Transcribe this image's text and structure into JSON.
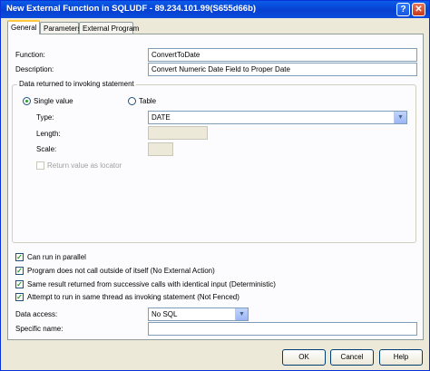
{
  "window": {
    "title": "New External Function in SQLUDF - 89.234.101.99(S655d66b)"
  },
  "tabs": [
    "General",
    "Parameters",
    "External Program"
  ],
  "general": {
    "function_label": "Function:",
    "function_value": "ConvertToDate",
    "description_label": "Description:",
    "description_value": "Convert Numeric Date Field to Proper Date"
  },
  "returned": {
    "legend": "Data returned to invoking statement",
    "single_value": "Single value",
    "table": "Table",
    "type_label": "Type:",
    "type_value": "DATE",
    "length_label": "Length:",
    "length_value": "",
    "scale_label": "Scale:",
    "scale_value": "",
    "locator_label": "Return value as locator"
  },
  "options": [
    {
      "label": "Can run in parallel",
      "checked": true
    },
    {
      "label": "Program does not call outside of itself (No External Action)",
      "checked": true
    },
    {
      "label": "Same result returned from successive calls with identical input (Deterministic)",
      "checked": true
    },
    {
      "label": "Attempt to run in same thread as invoking statement (Not Fenced)",
      "checked": true
    }
  ],
  "data_access": {
    "label": "Data access:",
    "value": "No SQL"
  },
  "specific_name": {
    "label": "Specific name:",
    "value": ""
  },
  "buttons": {
    "ok": "OK",
    "cancel": "Cancel",
    "help": "Help"
  },
  "icons": {
    "help": "?",
    "close": "✕",
    "check": "✓",
    "dropdown": "▼"
  }
}
